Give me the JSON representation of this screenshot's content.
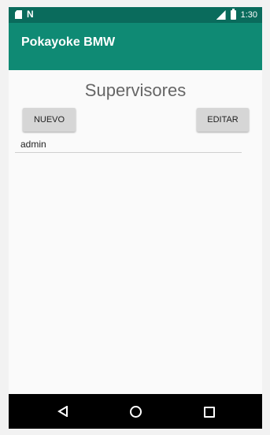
{
  "status_bar": {
    "time": "1:30",
    "icons": [
      "sd-card-icon",
      "n-icon",
      "signal-icon",
      "battery-icon"
    ]
  },
  "app_bar": {
    "title": "Pokayoke BMW"
  },
  "main": {
    "title": "Supervisores",
    "buttons": {
      "new_label": "NUEVO",
      "edit_label": "EDITAR"
    },
    "list": [
      {
        "label": "admin"
      }
    ]
  },
  "nav_bar": {
    "icons": [
      "back-icon",
      "home-icon",
      "recent-apps-icon"
    ]
  },
  "colors": {
    "status_bar": "#0a6b5c",
    "app_bar": "#0f8a74",
    "button": "#d6d6d6",
    "content_bg": "#fafafa"
  }
}
